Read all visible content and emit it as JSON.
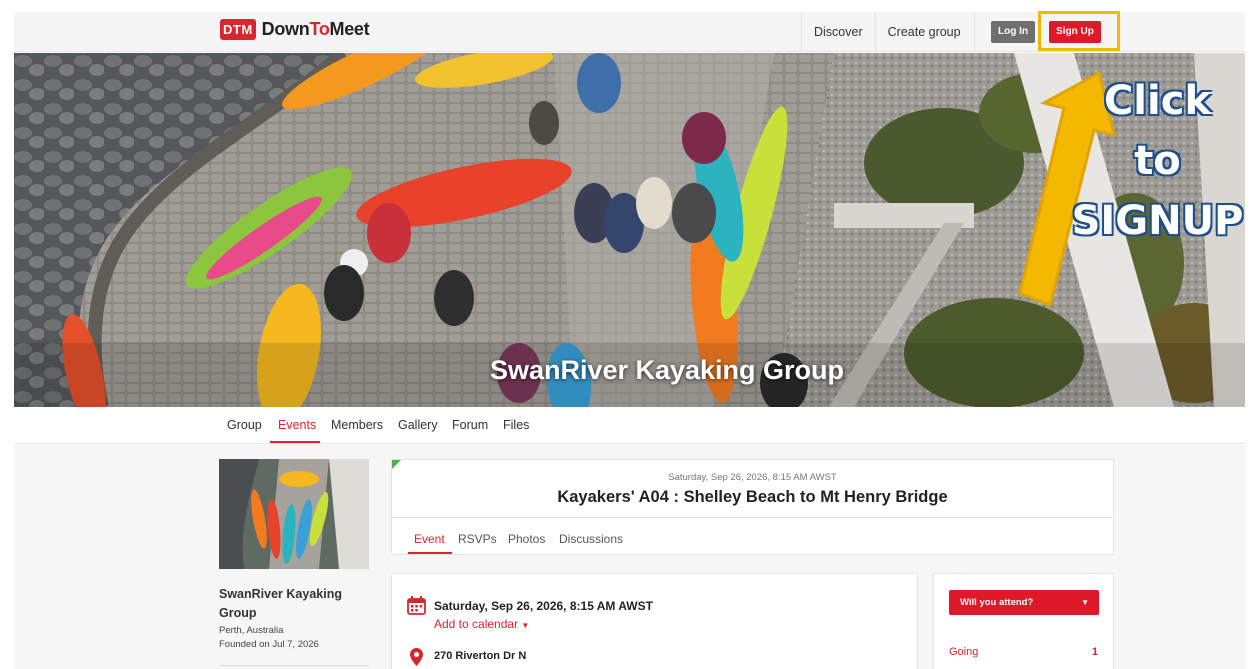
{
  "brand": {
    "badge": "DTM",
    "name_part1": "Down",
    "name_part2": "To",
    "name_part3": "Meet"
  },
  "topnav": {
    "discover": "Discover",
    "create_group": "Create group",
    "login": "Log In",
    "signup": "Sign Up"
  },
  "hero": {
    "title": "SwanRiver Kayaking Group",
    "callout_line1": "Click",
    "callout_line2": "to",
    "callout_line3": "SIGNUP"
  },
  "group_tabs": [
    "Group",
    "Events",
    "Members",
    "Gallery",
    "Forum",
    "Files"
  ],
  "group_tabs_active": "Events",
  "group_info": {
    "name": "SwanRiver Kayaking Group",
    "location": "Perth, Australia",
    "founded": "Founded on Jul 7, 2026"
  },
  "event": {
    "datetime_small": "Saturday, Sep 26, 2026, 8:15 AM AWST",
    "title": "Kayakers' A04 : Shelley Beach to Mt Henry Bridge",
    "tabs": [
      "Event",
      "RSVPs",
      "Photos",
      "Discussions"
    ],
    "active_tab": "Event",
    "date_full": "Saturday, Sep 26, 2026, 8:15 AM AWST",
    "add_to_calendar": "Add to calendar",
    "address": "270 Riverton Dr N"
  },
  "rsvp": {
    "prompt": "Will you attend?",
    "going_label": "Going",
    "going_count": "1"
  },
  "colors": {
    "brand_red": "#d8252e",
    "signup_red": "#e0192a",
    "highlight_yellow": "#f5b800",
    "callout_outline": "#1e4f8c"
  }
}
